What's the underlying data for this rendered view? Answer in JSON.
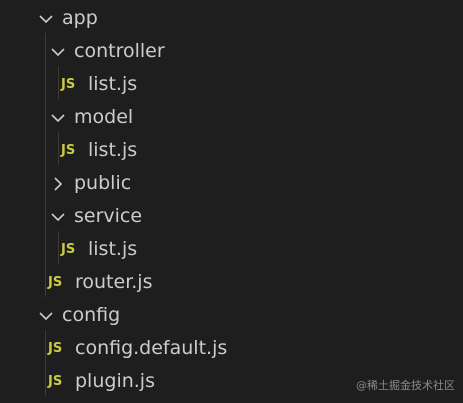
{
  "tree": {
    "items": [
      {
        "label": "app",
        "kind": "folder",
        "expanded": true,
        "icon": "chevron-down-icon"
      },
      {
        "label": "controller",
        "kind": "folder",
        "expanded": true,
        "icon": "chevron-down-icon"
      },
      {
        "label": "list.js",
        "kind": "file",
        "icon": "js-file-icon",
        "badge": "JS"
      },
      {
        "label": "model",
        "kind": "folder",
        "expanded": true,
        "icon": "chevron-down-icon"
      },
      {
        "label": "list.js",
        "kind": "file",
        "icon": "js-file-icon",
        "badge": "JS"
      },
      {
        "label": "public",
        "kind": "folder",
        "expanded": false,
        "icon": "chevron-right-icon"
      },
      {
        "label": "service",
        "kind": "folder",
        "expanded": true,
        "icon": "chevron-down-icon"
      },
      {
        "label": "list.js",
        "kind": "file",
        "icon": "js-file-icon",
        "badge": "JS"
      },
      {
        "label": "router.js",
        "kind": "file",
        "icon": "js-file-icon",
        "badge": "JS"
      },
      {
        "label": "config",
        "kind": "folder",
        "expanded": true,
        "icon": "chevron-down-icon"
      },
      {
        "label": "config.default.js",
        "kind": "file",
        "icon": "js-file-icon",
        "badge": "JS"
      },
      {
        "label": "plugin.js",
        "kind": "file",
        "icon": "js-file-icon",
        "badge": "JS"
      }
    ]
  },
  "colors": {
    "background": "#1e1e1e",
    "text": "#cccccc",
    "js_badge": "#cbcb41",
    "indent_guide": "#3b3b3b"
  },
  "watermark": "@稀土掘金技术社区"
}
